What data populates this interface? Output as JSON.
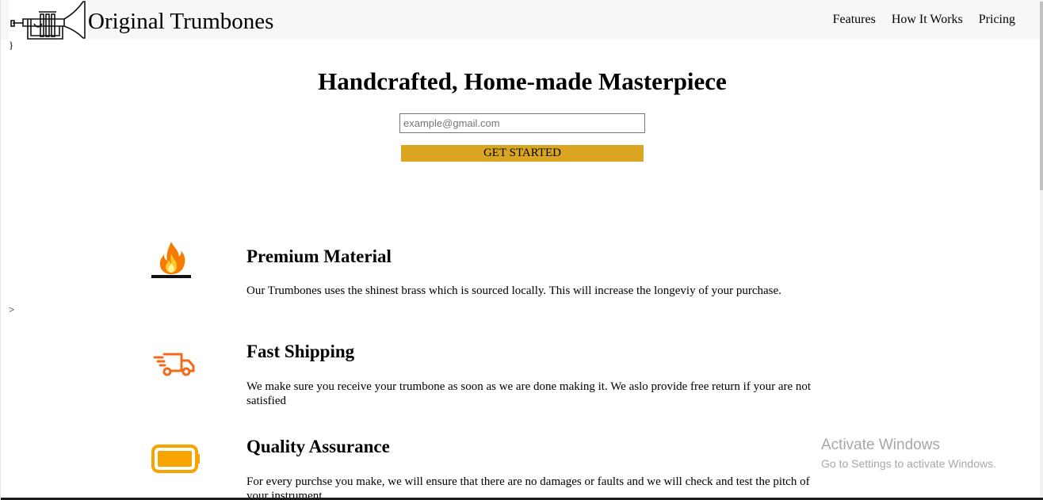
{
  "header": {
    "logo_icon": "trumpet-icon",
    "brand": "Original Trumbones",
    "nav": [
      "Features",
      "How It Works",
      "Pricing"
    ]
  },
  "stray_chars": {
    "top": "}",
    "middle": ">"
  },
  "hero": {
    "title": "Handcrafted, Home-made Masterpiece",
    "email_placeholder": "example@gmail.com",
    "button_label": "GET STARTED"
  },
  "features": [
    {
      "icon": "fire-icon",
      "title": "Premium Material",
      "text": "Our Trumbones uses the shinest brass which is sourced locally. This will increase the longeviy of your purchase."
    },
    {
      "icon": "shipping-truck-icon",
      "title": "Fast Shipping",
      "text": "We make sure you receive your trumbone as soon as we are done making it. We aslo provide free return if your are not satisfied"
    },
    {
      "icon": "battery-icon",
      "title": "Quality Assurance",
      "text": "For every purchse you make, we will ensure that there are no damages or faults and we will check and test the pitch of your instrument."
    }
  ],
  "watermark": {
    "title": "Activate Windows",
    "subtitle": "Go to Settings to activate Windows."
  },
  "colors": {
    "cta": "#daa520",
    "header_bg": "#f8f7f6",
    "icon_orange": "#f26b1d",
    "icon_amber": "#f7a400"
  }
}
